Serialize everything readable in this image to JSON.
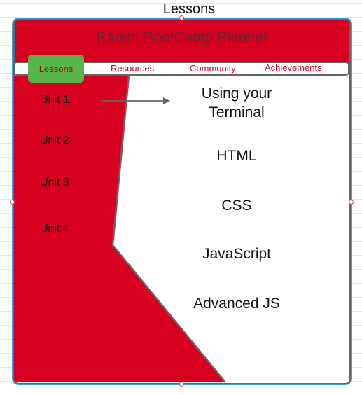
{
  "diagram": {
    "title": "Lessons"
  },
  "header": {
    "title": "Parent BootCamp Planner"
  },
  "nav": {
    "items": [
      {
        "label": "Lessons",
        "active": true
      },
      {
        "label": "Resources"
      },
      {
        "label": "Community"
      },
      {
        "label": "Achievements"
      }
    ]
  },
  "sidebar": {
    "units": [
      {
        "label": "Unit 1"
      },
      {
        "label": "Unit 2"
      },
      {
        "label": "Unit 3"
      },
      {
        "label": "Unit 4"
      }
    ]
  },
  "lessons": {
    "items": [
      {
        "label": "Using your Terminal"
      },
      {
        "label": "HTML"
      },
      {
        "label": "CSS"
      },
      {
        "label": "JavaScript"
      },
      {
        "label": "Advanced JS"
      }
    ]
  },
  "colors": {
    "frame": "#3aa1d9",
    "header_red": "#d7001f",
    "active_green": "#58b548",
    "outline": "#666666"
  }
}
